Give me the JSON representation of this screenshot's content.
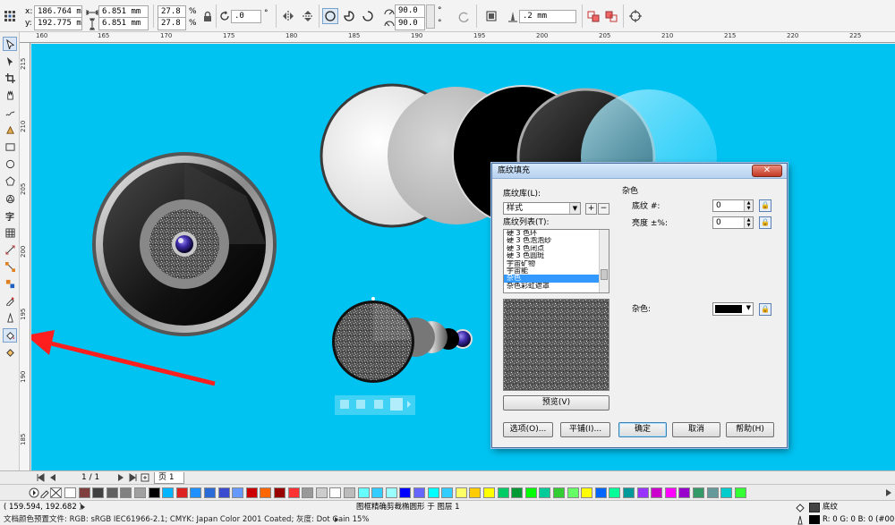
{
  "propbar": {
    "x_label": "x:",
    "x_value": "186.764 mm",
    "y_label": "y:",
    "y_value": "192.775 mm",
    "w_value": "6.851 mm",
    "h_value": "6.851 mm",
    "scale_x": "27.8",
    "scale_y": "27.8",
    "percent": "%",
    "rotation": ".0",
    "degree": "°",
    "angle1": "90.0",
    "angle2": "90.0",
    "outline_width": ".2 mm"
  },
  "ruler": {
    "h_ticks": [
      "160",
      "165",
      "170",
      "175",
      "180",
      "185",
      "190",
      "195",
      "200",
      "205",
      "210",
      "215",
      "220",
      "225"
    ],
    "v_ticks": [
      "215",
      "210",
      "205",
      "200",
      "195",
      "190",
      "185"
    ]
  },
  "toolbox": {
    "text_tool_glyph": "字"
  },
  "pagebar": {
    "page_counter": "1 / 1",
    "page_tab": "页 1"
  },
  "palette": {
    "colors": [
      "#ffffff",
      "#7f3f3f",
      "#404040",
      "#606060",
      "#808080",
      "#a0a0a0",
      "#000000",
      "#00b4ff",
      "#dd2222",
      "#1e90ff",
      "#2a6bd8",
      "#3a4bd0",
      "#6699ff",
      "#cc0000",
      "#ff6600",
      "#990000",
      "#ff3333",
      "#999999",
      "#cccccc",
      "#ffffff",
      "#bbbbbb",
      "#66ffff",
      "#33ccff",
      "#99ffff",
      "#0000ff",
      "#6666ff",
      "#00ffff",
      "#33ccff",
      "#ffff66",
      "#ffcc00",
      "#ffff00",
      "#00cc66",
      "#009933",
      "#00ff00",
      "#00cc99",
      "#33cc33",
      "#66ff66",
      "#ffff00",
      "#0066ff",
      "#00ff99",
      "#009999",
      "#9933ff",
      "#cc00cc",
      "#ff00ff",
      "#9900cc",
      "#339966",
      "#669999",
      "#00cccc",
      "#33ff33"
    ]
  },
  "status": {
    "coords": "( 159.594, 192.682 )",
    "doc_profile": "文档颜色预置文件: RGB: sRGB IEC61966-2.1; CMYK: Japan Color 2001 Coated; 灰度: Dot Gain 15%",
    "object_info": "图框精确剪裁椭圆形 于 图层 1",
    "fill_name": "底纹",
    "fill_values": "R: 0 G: 0 B: 0 (#00000"
  },
  "dialog": {
    "title": "底纹填充",
    "close_glyph": "✕",
    "library_label": "底纹库(L):",
    "library_value": "样式",
    "list_label": "底纹列表(T):",
    "list_items": [
      "硬 3 色环",
      "硬 3 色泡泡纱",
      "硬 3 色闭点",
      "硬 3 色圆斑",
      "宇宙矿物",
      "宇宙能",
      "杂色",
      "杂色彩虹遮罩"
    ],
    "selected_index": 6,
    "preview_button": "预览(V)",
    "section_title": "杂色",
    "param1_label": "底纹 #:",
    "param1_value": "0",
    "param2_label": "亮度 ±%:",
    "param2_value": "0",
    "color_label": "杂色:",
    "btn_options": "选项(O)...",
    "btn_tile": "平铺(I)...",
    "btn_ok": "确定",
    "btn_cancel": "取消",
    "btn_help": "帮助(H)"
  }
}
